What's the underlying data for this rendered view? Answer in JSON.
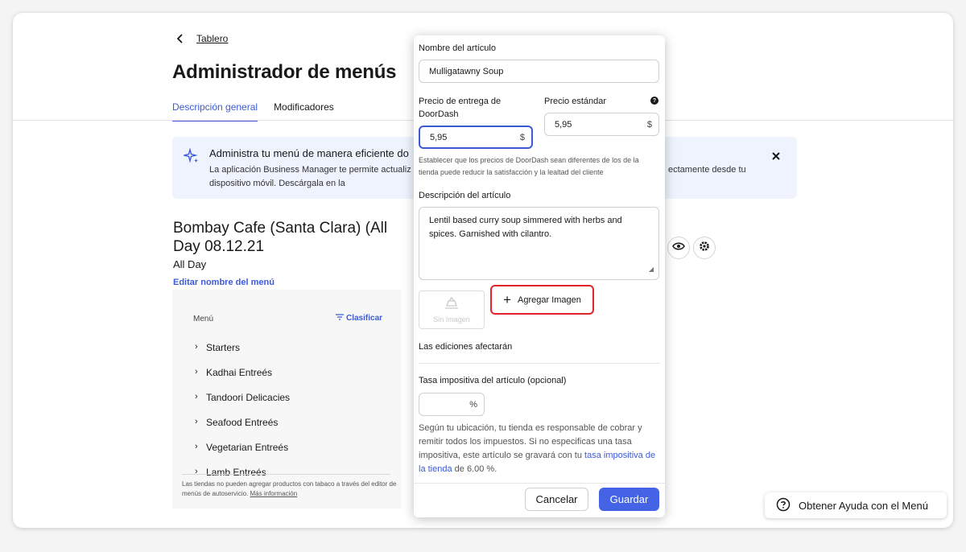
{
  "header": {
    "back_label": "Tablero",
    "title": "Administrador de menús",
    "tabs": [
      {
        "label": "Descripción general",
        "active": true
      },
      {
        "label": "Modificadores",
        "active": false
      }
    ]
  },
  "banner": {
    "title": "Administra tu menú de manera eficiente do",
    "text_left": "La aplicación Business Manager te permite actualiz",
    "text_right": "ectamente desde tu",
    "text_line2": "dispositivo móvil. Descárgala en la"
  },
  "menu": {
    "name": "Bombay Cafe (Santa Clara) (All Day 08.12.21",
    "hours": "All Day",
    "edit_label": "Editar nombre del menú",
    "list_header": "Menú",
    "sort_label": "Clasificar",
    "categories": [
      "Starters",
      "Kadhai Entreés",
      "Tandoori Delicacies",
      "Seafood Entreés",
      "Vegetarian Entreés",
      "Lamb Entreés"
    ],
    "footer_text": "Las tiendas no pueden agregar productos con tabaco a través del editor de menús de autoservicio.",
    "footer_link": "Más información"
  },
  "help_button": "Obtener Ayuda con el Menú",
  "modal": {
    "item_name_label": "Nombre del artículo",
    "item_name_value": "Mulligatawny Soup",
    "dd_price_label": "Precio de entrega de DoorDash",
    "dd_price_value": "5,95",
    "std_price_label": "Precio estándar",
    "std_price_value": "5,95",
    "currency": "$",
    "price_hint": "Establecer que los precios de DoorDash sean diferentes de los de la tienda puede reducir la satisfacción y la lealtad del cliente",
    "desc_label": "Descripción del artículo",
    "desc_value": "Lentil based curry soup simmered with herbs and spices. Garnished with cilantro.",
    "no_image": "Sin Imagen",
    "add_image": "Agregar Imagen",
    "edits_note": "Las ediciones afectarán",
    "tax_label": "Tasa impositiva del artículo (opcional)",
    "tax_value": "",
    "percent": "%",
    "tax_note_1": "Según tu ubicación, tu tienda es responsable de cobrar y remitir todos los impuestos. Si no especificas una tasa impositiva, este artículo se gravará con tu ",
    "tax_note_link": "tasa impositiva de la tienda",
    "tax_note_2": " de 6.00 %.",
    "cancel": "Cancelar",
    "save": "Guardar"
  },
  "colors": {
    "accent": "#3c5ad8",
    "save": "#4564e5",
    "highlight": "#e0242a",
    "banner": "#eef3fd"
  }
}
